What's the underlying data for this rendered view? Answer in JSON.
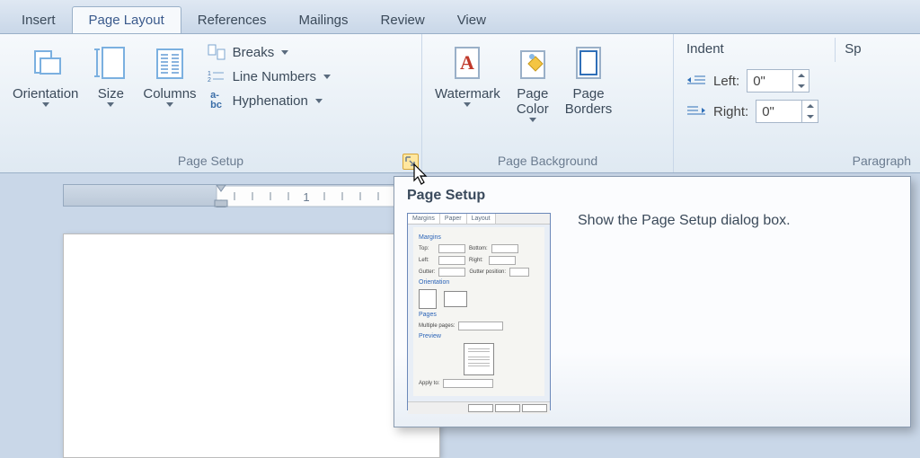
{
  "tabs": [
    {
      "label": "Insert"
    },
    {
      "label": "Page Layout",
      "active": true
    },
    {
      "label": "References"
    },
    {
      "label": "Mailings"
    },
    {
      "label": "Review"
    },
    {
      "label": "View"
    }
  ],
  "groups": {
    "page_setup": {
      "label": "Page Setup",
      "orientation": "Orientation",
      "size": "Size",
      "columns": "Columns",
      "breaks": "Breaks",
      "line_numbers": "Line Numbers",
      "hyphenation": "Hyphenation"
    },
    "page_background": {
      "label": "Page Background",
      "watermark": "Watermark",
      "page_color": "Page\nColor",
      "page_borders": "Page\nBorders"
    },
    "paragraph": {
      "label": "Paragraph",
      "indent_title": "Indent",
      "left_label": "Left:",
      "left_value": "0\"",
      "right_label": "Right:",
      "right_value": "0\"",
      "spacing_title": "Sp"
    }
  },
  "tooltip": {
    "title": "Page Setup",
    "text": "Show the Page Setup dialog box.",
    "preview_tabs": [
      "Margins",
      "Paper",
      "Layout"
    ],
    "preview_margins": "Margins",
    "preview_orientation": "Orientation",
    "preview_pages": "Pages",
    "preview_preview": "Preview"
  },
  "ruler_mark": "1"
}
